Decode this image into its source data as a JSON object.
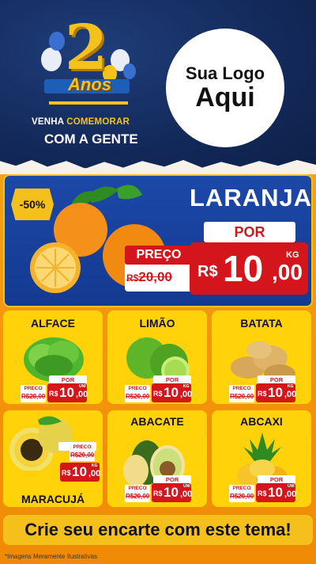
{
  "header": {
    "badge_number": "2",
    "badge_label": "Anos",
    "tagline_prefix": "VENHA ",
    "tagline_highlight": "COMEMORAR",
    "tagline_line2": "COM A GENTE",
    "logo_line1": "Sua Logo",
    "logo_line2": "Aqui"
  },
  "colors": {
    "header_bg": "#13295a",
    "accent_yellow": "#f6c01c",
    "price_red": "#d4161c",
    "feature_blue": "#1c48a8",
    "body_orange": "#f59a0a"
  },
  "featured": {
    "discount": "-50%",
    "name": "LARANJA",
    "por_label": "POR",
    "preco_label": "PREÇO",
    "old_currency": "R$",
    "old_price": "20,00",
    "currency": "R$",
    "price_int": "10",
    "price_dec": ",00",
    "unit": "KG",
    "image_icon": "orange-icon"
  },
  "products": [
    {
      "name": "ALFACE",
      "icon": "lettuce-icon",
      "por": "POR",
      "preco": "PRECO",
      "old": "R$20,00",
      "currency": "R$",
      "int": "10",
      "dec": ",00",
      "unit": "UNI"
    },
    {
      "name": "LIMÃO",
      "icon": "lime-icon",
      "por": "POR",
      "preco": "PRECO",
      "old": "R$20,00",
      "currency": "R$",
      "int": "10",
      "dec": ",00",
      "unit": "KG"
    },
    {
      "name": "BATATA",
      "icon": "potato-icon",
      "por": "POR",
      "preco": "PRECO",
      "old": "R$20,00",
      "currency": "R$",
      "int": "10",
      "dec": ",00",
      "unit": "KG"
    },
    {
      "name": "MARACUJÁ",
      "icon": "passion-fruit-icon",
      "por": "POR",
      "preco": "PRECO",
      "old": "R$20,00",
      "currency": "R$",
      "int": "10",
      "dec": ",00",
      "unit": "KG"
    },
    {
      "name": "ABACATE",
      "icon": "avocado-icon",
      "por": "POR",
      "preco": "PRECO",
      "old": "R$20,00",
      "currency": "R$",
      "int": "10",
      "dec": ",00",
      "unit": "UNI"
    },
    {
      "name": "ABCAXI",
      "icon": "pineapple-icon",
      "por": "POR",
      "preco": "PRECO",
      "old": "R$20,00",
      "currency": "R$",
      "int": "10",
      "dec": ",00",
      "unit": "UNI"
    }
  ],
  "footer": {
    "banner": "Crie seu encarte com este tema!",
    "disclaimer": "*Imagens Meramente Ilustrativas"
  }
}
